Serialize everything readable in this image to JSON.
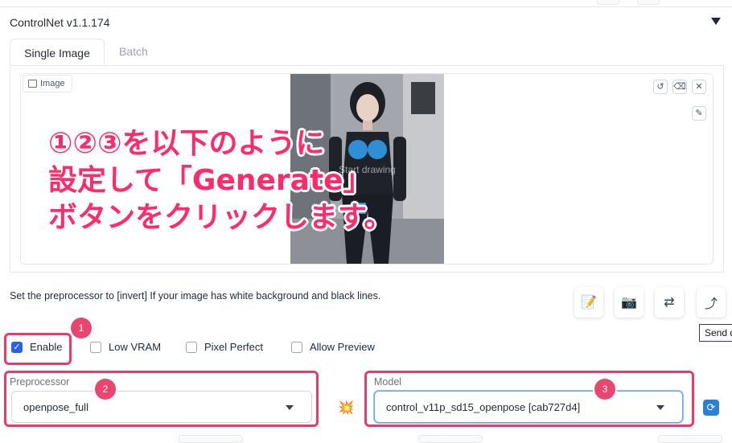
{
  "controlnet": {
    "title": "ControlNet v1.1.174",
    "tabs": [
      "Single Image",
      "Batch"
    ]
  },
  "image_panel": {
    "label": "Image",
    "watermark": "Start drawing",
    "tools": [
      "undo-icon",
      "eraser-icon",
      "close-icon",
      "brush-icon"
    ]
  },
  "overlay": {
    "line1": "①②③を以下のように",
    "line2": "設定して「Generate」",
    "line3": "ボタンをクリックします。"
  },
  "hint": "Set the preprocessor to [invert] If your image has white background and black lines.",
  "action_buttons": {
    "icons": [
      "edit-icon",
      "camera-icon",
      "swap-icon",
      "send-dimensions-icon"
    ],
    "tooltip": "Send d"
  },
  "checkboxes": [
    {
      "label": "Enable",
      "checked": true
    },
    {
      "label": "Low VRAM",
      "checked": false
    },
    {
      "label": "Pixel Perfect",
      "checked": false
    },
    {
      "label": "Allow Preview",
      "checked": false
    }
  ],
  "preprocessor": {
    "label": "Preprocessor",
    "value": "openpose_full"
  },
  "model": {
    "label": "Model",
    "value": "control_v11p_sd15_openpose [cab727d4]"
  },
  "badges": [
    "1",
    "2",
    "3"
  ],
  "colors": {
    "highlight": "#e83a6b",
    "badge": "#e8456f",
    "overlay_text": "#ff2a6a",
    "checkbox_checked": "#2563eb",
    "refresh": "#2b7fd9"
  }
}
